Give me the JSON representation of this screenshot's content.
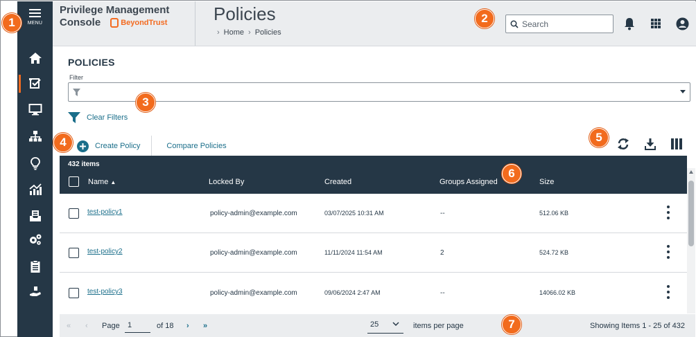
{
  "nav": {
    "menu_label": "MENU",
    "items": [
      {
        "icon": "home-icon",
        "active": false
      },
      {
        "icon": "policies-icon",
        "active": true
      },
      {
        "icon": "computer-icon",
        "active": false
      },
      {
        "icon": "groups-icon",
        "active": false
      },
      {
        "icon": "lightbulb-icon",
        "active": false
      },
      {
        "icon": "analytics-icon",
        "active": false
      },
      {
        "icon": "inbox-icon",
        "active": false
      },
      {
        "icon": "configuration-icon",
        "active": false
      },
      {
        "icon": "clipboard-icon",
        "active": false
      },
      {
        "icon": "deploy-icon",
        "active": false
      }
    ]
  },
  "header": {
    "app_title_line1": "Privilege Management",
    "app_title_line2": "Console",
    "vendor": "BeyondTrust",
    "page_title": "Policies",
    "breadcrumb": [
      "Home",
      "Policies"
    ],
    "search_placeholder": "Search"
  },
  "content": {
    "section_title": "POLICIES",
    "filter_label": "Filter",
    "clear_filters": "Clear Filters",
    "create_policy": "Create Policy",
    "compare_policies": "Compare Policies"
  },
  "grid": {
    "item_count": "432 items",
    "columns": [
      "Name",
      "Locked By",
      "Created",
      "Groups Assigned",
      "Size"
    ],
    "sort_indicator": "▲",
    "rows": [
      {
        "name": "test-policy1",
        "locked_by": "policy-admin@example.com",
        "created": "03/07/2025 10:31 AM",
        "groups": "--",
        "size": "512.06 KB"
      },
      {
        "name": "test-policy2",
        "locked_by": "policy-admin@example.com",
        "created": "11/11/2024 11:54 AM",
        "groups": "2",
        "size": "524.72 KB"
      },
      {
        "name": "test-policy3",
        "locked_by": "policy-admin@example.com",
        "created": "09/06/2024 2:47 AM",
        "groups": "--",
        "size": "14066.02 KB"
      }
    ]
  },
  "pager": {
    "page_label": "Page",
    "page_value": "1",
    "of_label": "of 18",
    "page_size": "25",
    "items_per_page": "items per page",
    "showing": "Showing Items 1 - 25 of 432"
  },
  "callouts": [
    "1",
    "2",
    "3",
    "4",
    "5",
    "6",
    "7"
  ],
  "colors": {
    "nav_bg": "#253746",
    "accent": "#f36b21",
    "link": "#1a6e8a",
    "callout": "#f26b1d"
  }
}
